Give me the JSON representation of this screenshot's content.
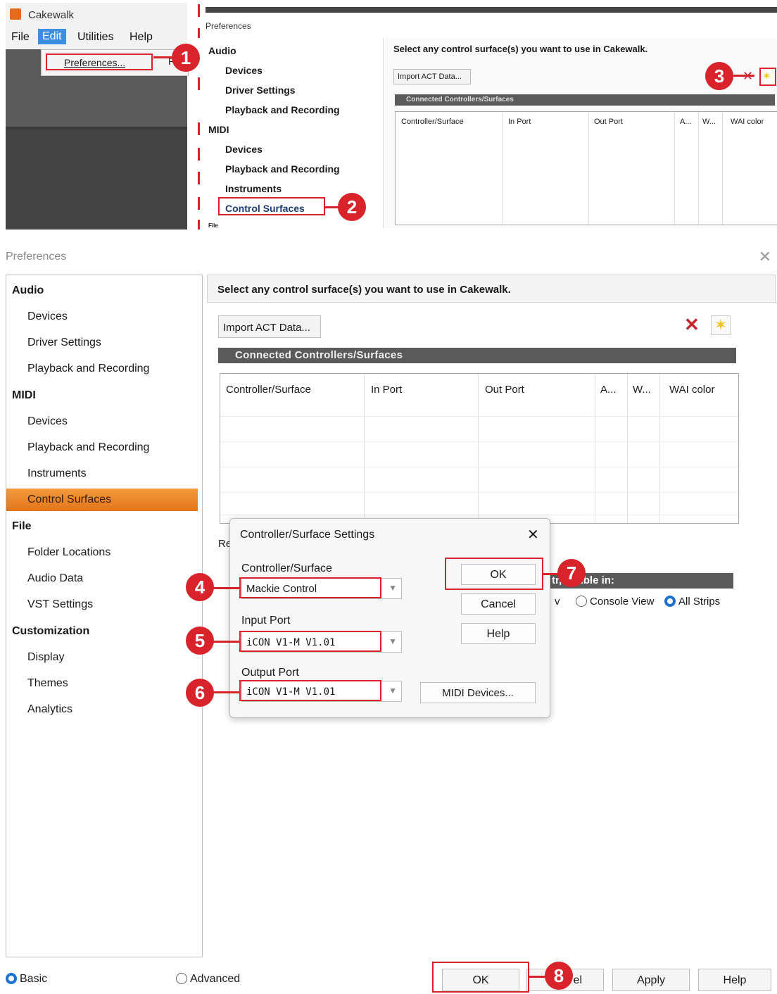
{
  "cakewalk": {
    "app_title": "Cakewalk",
    "menus": [
      "File",
      "Edit",
      "Utilities",
      "Help"
    ],
    "preferences_item": "Preferences...",
    "preferences_extra": "P"
  },
  "small_pref": {
    "title": "Preferences",
    "nav": {
      "audio": "Audio",
      "audio_devices": "Devices",
      "driver_settings": "Driver Settings",
      "audio_playback": "Playback and Recording",
      "midi": "MIDI",
      "midi_devices": "Devices",
      "midi_playback": "Playback and Recording",
      "instruments": "Instruments",
      "control_surfaces": "Control Surfaces",
      "file": "File"
    },
    "heading": "Select any control surface(s) you want to use in Cakewalk.",
    "import_btn": "Import ACT Data...",
    "connected_bar": "Connected Controllers/Surfaces",
    "columns": [
      "Controller/Surface",
      "In Port",
      "Out Port",
      "A...",
      "W...",
      "WAI color"
    ]
  },
  "main_pref": {
    "title": "Preferences",
    "nav": {
      "audio": "Audio",
      "audio_devices": "Devices",
      "driver_settings": "Driver Settings",
      "audio_playback": "Playback and Recording",
      "midi": "MIDI",
      "midi_devices": "Devices",
      "midi_playback": "Playback and Recording",
      "instruments": "Instruments",
      "control_surfaces": "Control Surfaces",
      "file": "File",
      "folder_locations": "Folder Locations",
      "audio_data": "Audio Data",
      "vst_settings": "VST Settings",
      "customization": "Customization",
      "display": "Display",
      "themes": "Themes",
      "analytics": "Analytics"
    },
    "heading": "Select any control surface(s) you want to use in Cakewalk.",
    "import_btn": "Import ACT Data...",
    "connected_bar": "Connected Controllers/Surfaces",
    "columns": [
      "Controller/Surface",
      "In Port",
      "Out Port",
      "A...",
      "W...",
      "WAI color"
    ],
    "remote_label": "Re",
    "visible_bar": "tr, Visible in:",
    "v_prefix": "v",
    "console_view": "Console View",
    "all_strips": "All Strips",
    "basic": "Basic",
    "advanced": "Advanced",
    "ok": "OK",
    "cancel_partial": "el",
    "apply": "Apply",
    "help": "Help"
  },
  "dialog": {
    "title": "Controller/Surface Settings",
    "controller_label": "Controller/Surface",
    "controller_value": "Mackie Control",
    "input_label": "Input Port",
    "input_value": "iCON V1-M V1.01",
    "output_label": "Output Port",
    "output_value": "iCON V1-M V1.01",
    "ok": "OK",
    "cancel": "Cancel",
    "help": "Help",
    "midi_devices": "MIDI Devices..."
  },
  "callouts": [
    "1",
    "2",
    "3",
    "4",
    "5",
    "6",
    "7",
    "8"
  ],
  "icons": {
    "close": "close-icon",
    "delete": "delete-surface-icon",
    "add": "add-surface-icon",
    "dropdown": "chevron-down-icon"
  },
  "colors": {
    "accent_red": "#d8232a",
    "selection_orange": "#e97f22",
    "header_bar": "#5a5a5a",
    "radio_blue": "#1f6fd1"
  }
}
